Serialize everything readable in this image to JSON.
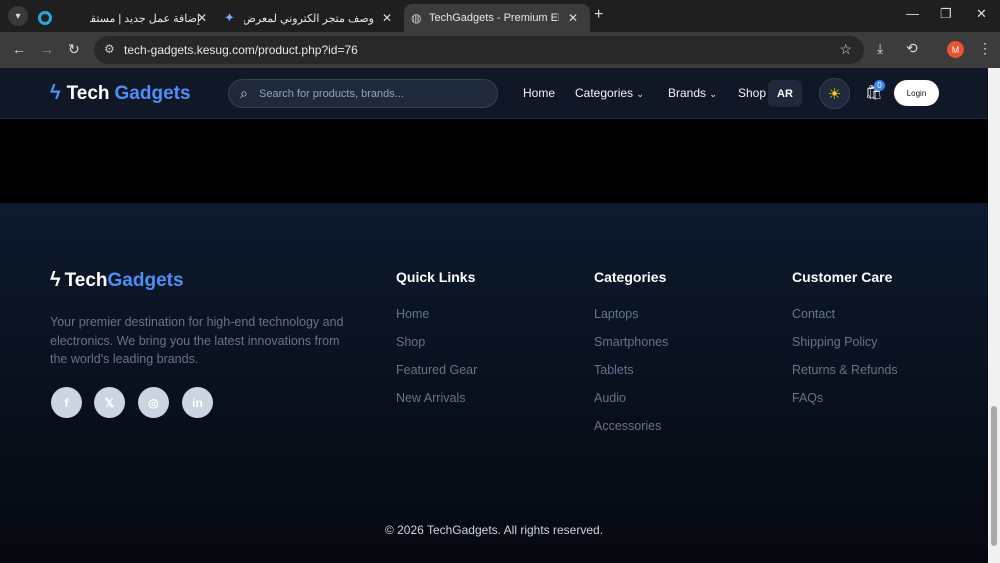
{
  "browser": {
    "tabs": [
      {
        "title": "إضافة عمل جديد | مستقل",
        "icon": "mostaql-icon"
      },
      {
        "title": "وصف متجر الكتروني لمعرض الأ...",
        "icon": "gemini-icon"
      },
      {
        "title": "TechGadgets - Premium Electro",
        "icon": "globe-icon"
      }
    ],
    "url": "tech-gadgets.kesug.com/product.php?id=76",
    "profile_initial": "M"
  },
  "nav": {
    "logo_main": "Tech",
    "logo_accent": "Gadgets",
    "search_placeholder": "Search for products, brands...",
    "links": {
      "home": "Home",
      "categories": "Categories",
      "brands": "Brands",
      "shop": "Shop"
    },
    "lang": "AR",
    "cart_count": "0",
    "login": "Login"
  },
  "footer": {
    "logo_main": "Tech",
    "logo_accent": "Gadgets",
    "description": "Your premier destination for high-end technology and electronics. We bring you the latest innovations from the world's leading brands.",
    "social": [
      "f",
      "𝕏",
      "◎",
      "in"
    ],
    "quick_links": {
      "title": "Quick Links",
      "items": [
        "Home",
        "Shop",
        "Featured Gear",
        "New Arrivals"
      ]
    },
    "categories": {
      "title": "Categories",
      "items": [
        "Laptops",
        "Smartphones",
        "Tablets",
        "Audio",
        "Accessories"
      ]
    },
    "customer_care": {
      "title": "Customer Care",
      "items": [
        "Contact",
        "Shipping Policy",
        "Returns & Refunds",
        "FAQs"
      ]
    },
    "copyright": "© 2026 TechGadgets. All rights reserved."
  },
  "colors": {
    "accent": "#4f8ef7",
    "nav_bg": "#101828",
    "footer_bg": "#0d1a2e"
  }
}
